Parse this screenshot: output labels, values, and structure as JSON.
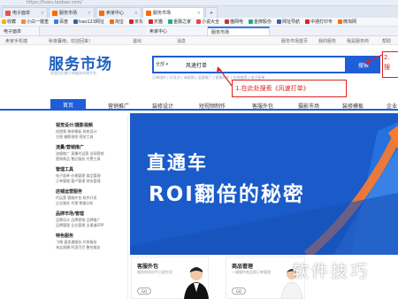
{
  "browser": {
    "address": "https://fuwu.taobao.com/",
    "tabs": [
      {
        "label": "电子面单",
        "color": "#e8524a",
        "active": false
      },
      {
        "label": "服务市场",
        "color": "#ff6a00",
        "active": false
      },
      {
        "label": "卖家中心",
        "color": "#ff6a00",
        "active": false
      },
      {
        "label": "服务市场",
        "color": "#ff6a00",
        "active": true
      },
      {
        "label": "",
        "color": "#3a7be0",
        "active": false
      }
    ],
    "bookmarks": [
      "收藏",
      "小白一键重",
      "百度",
      "hao123网址",
      "淘宝",
      "京东",
      "天猫",
      "金融之家",
      "小说大全",
      "猫网电",
      "金牌股份",
      "网址导航",
      "中通打印专",
      "微淘网"
    ],
    "page_tabs": [
      "电子面单",
      "卖家中心",
      "服务市场"
    ]
  },
  "topbar": {
    "left": "卖家手机端",
    "greeting": "秋夜暮雨，欢迎回来！",
    "logout": "退出",
    "messages": "消息",
    "right": [
      "服务市场首页",
      "我的服务",
      "我是服务商",
      "帮助"
    ]
  },
  "header": {
    "logo": "服务市场",
    "slogan": "阿里巴巴旗下的服务市场平台",
    "search": {
      "category": "全部",
      "value": "风速打单",
      "button": "搜索",
      "hot": "订单组件 | 打处方 | 淘抢购 | 运营推广  |  智能同步 | 在线推荐 | 电子面单"
    }
  },
  "annotations": {
    "step1": "1.在此处搜索《风速打单》",
    "step2": "2.\n搜"
  },
  "nav": {
    "home": "首页",
    "items": [
      "营销推广",
      "装修设计",
      "短视频制作",
      "客服外包",
      "摄影市场",
      "装修模板",
      "企业"
    ]
  },
  "left_menu": [
    {
      "title": "视觉设计/摄影视频",
      "lines": [
        "短视频  装修模板  装修设计",
        "主图  摄影拍照  视觉工具"
      ]
    },
    {
      "title": "流量/营销推广",
      "lines": [
        "流量推广  直播代运营  全网营销",
        "营销商品  售后服务  付费工具"
      ]
    },
    {
      "title": "管理工具",
      "lines": [
        "电子面单  价格管理  商品管理",
        "订单管理  客户管理  财务管理"
      ]
    },
    {
      "title": "店铺运营服务",
      "lines": [
        "代运营  客服外包  软件开发",
        "企业服务  代理  数据分析"
      ]
    },
    {
      "title": "品牌市场/管理",
      "lines": [
        "品牌设计  品牌营销  品牌推广",
        "品牌管理  企业管理  全渠道ERP"
      ]
    },
    {
      "title": "特色服务",
      "lines": [
        "飞猪  速卖通服务  外贸服务",
        "淘宝直播  阿里巴巴  整合服务"
      ]
    }
  ],
  "banner": {
    "line1": "直通车",
    "line2": "ROI翻倍的秘密",
    "bg": "#1a5bc9"
  },
  "cards": [
    {
      "title": "客服外包",
      "sub": "服务你的对手已经在用",
      "go": "GO"
    },
    {
      "title": "商品管理",
      "sub": "一键操作商品和订单管理",
      "go": "GO"
    }
  ],
  "watermark": "软件技巧",
  "colors": {
    "brand": "#1f5ed8",
    "annotation": "#e02020"
  }
}
